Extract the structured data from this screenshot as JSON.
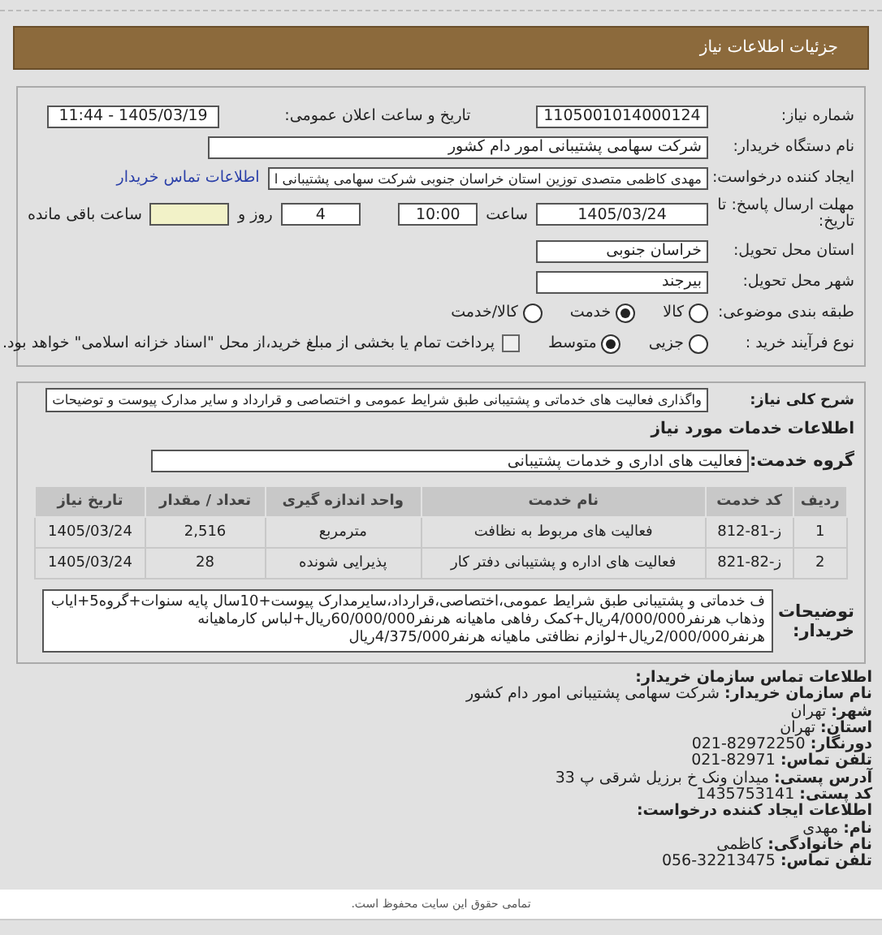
{
  "header": {
    "title": "جزئیات اطلاعات نیاز"
  },
  "details": {
    "need_number": {
      "label": "شماره نیاز:",
      "value": "1105001014000124"
    },
    "announce": {
      "label": "تاریخ و ساعت اعلان عمومی:",
      "value": "1405/03/19 - 11:44"
    },
    "buyer": {
      "label": "نام دستگاه خریدار:",
      "value": "شرکت سهامی پشتیبانی امور دام کشور"
    },
    "creator": {
      "label": "ایجاد کننده درخواست:",
      "value": "مهدی کاظمی متصدی توزین استان خراسان جنوبی شرکت سهامی پشتیبانی ا",
      "link": "اطلاعات تماس خریدار"
    },
    "deadline": {
      "label": "مهلت ارسال پاسخ: تا تاریخ:",
      "date": "1405/03/24",
      "time_label": "ساعت",
      "time": "10:00",
      "days": "4",
      "days_label": "روز و",
      "remaining_label": "ساعت باقی مانده"
    },
    "province": {
      "label": "استان محل تحویل:",
      "value": "خراسان جنوبی"
    },
    "city": {
      "label": "شهر محل تحویل:",
      "value": "بیرجند"
    },
    "category": {
      "label": "طبقه بندی موضوعی:",
      "options": [
        {
          "label": "کالا",
          "selected": false
        },
        {
          "label": "خدمت",
          "selected": true
        },
        {
          "label": "کالا/خدمت",
          "selected": false
        }
      ]
    },
    "process": {
      "label": "نوع فرآیند خرید :",
      "options": [
        {
          "label": "جزیی",
          "selected": false
        },
        {
          "label": "متوسط",
          "selected": true
        }
      ],
      "treasury": {
        "label": "پرداخت تمام یا بخشی از مبلغ خرید،از محل \"اسناد خزانه اسلامی\" خواهد بود.",
        "checked": false
      }
    }
  },
  "services": {
    "description": {
      "label": "شرح کلی نیاز:",
      "value": "واگذاری فعالیت های خدماتی و پشتیبانی طبق شرایط عمومی و اختصاصی و قرارداد و سایر مدارک پیوست و توضیحات"
    },
    "section_title": "اطلاعات خدمات مورد نیاز",
    "group": {
      "label": "گروه خدمت:",
      "value": "فعالیت های اداری و خدمات پشتیبانی"
    },
    "table": {
      "columns": [
        "ردیف",
        "کد خدمت",
        "نام خدمت",
        "واحد اندازه گیری",
        "تعداد / مقدار",
        "تاریخ نیاز"
      ],
      "rows": [
        [
          "1",
          "ز-81-812",
          "فعالیت های مربوط به نظافت",
          "مترمربع",
          "2,516",
          "1405/03/24"
        ],
        [
          "2",
          "ز-82-821",
          "فعالیت های اداره و پشتیبانی دفتر کار",
          "پذیرایی شونده",
          "28",
          "1405/03/24"
        ]
      ]
    },
    "notes": {
      "label": "توضیحات خریدار:",
      "value": "ف خدماتی و پشتیبانی طبق شرایط عمومی،اختصاصی،قرارداد،سایرمدارک پیوست+10سال پایه سنوات+گروه5+ایاب وذهاب هرنفر4/000/000ریال+کمک رفاهی ماهیانه هرنفر60/000/000ریال+لباس کارماهیانه هرنفر2/000/000ریال+لوازم نظافتی ماهیانه هرنفر4/375/000ریال"
    }
  },
  "contact": {
    "title": "اطلاعات تماس سازمان خریدار:",
    "lines": [
      {
        "label": "نام سازمان خریدار:",
        "value": "شرکت سهامی پشتیبانی امور دام کشور"
      },
      {
        "label": "شهر:",
        "value": "تهران"
      },
      {
        "label": "استان:",
        "value": "تهران"
      },
      {
        "label": "دورنگار:",
        "value": "82972250-021"
      },
      {
        "label": "تلفن تماس:",
        "value": "82971-021"
      },
      {
        "label": "آدرس پستی:",
        "value": "میدان ونک خ برزیل شرقی پ 33"
      },
      {
        "label": "کد پستی:",
        "value": "1435753141"
      }
    ],
    "creator_title": "اطلاعات ایجاد کننده درخواست:",
    "creator_lines": [
      {
        "label": "نام:",
        "value": "مهدی"
      },
      {
        "label": "نام خانوادگی:",
        "value": "کاظمی"
      },
      {
        "label": "تلفن تماس:",
        "value": "32213475-056"
      }
    ]
  },
  "footer": "تمامی حقوق این سایت محفوظ است."
}
